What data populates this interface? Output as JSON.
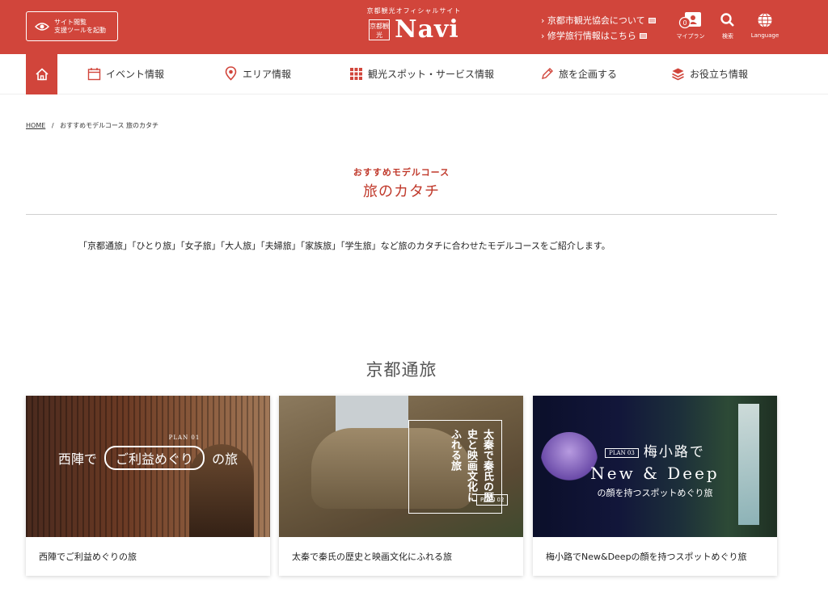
{
  "header": {
    "a11y_button": "サイト閲覧\n支援ツールを起動",
    "logo_tagline": "京都観光オフィシャルサイト",
    "logo_seal": "京都観光",
    "logo_name": "Navi",
    "links": [
      "京都市観光協会について",
      "修学旅行情報はこちら"
    ],
    "tools": {
      "myplan_count": "0",
      "myplan_label": "マイプラン",
      "search_label": "検索",
      "language_label": "Language"
    }
  },
  "nav": {
    "items": [
      "イベント情報",
      "エリア情報",
      "観光スポット・サービス情報",
      "旅を企画する",
      "お役立ち情報"
    ]
  },
  "breadcrumb": {
    "home": "HOME",
    "current": "おすすめモデルコース 旅のカタチ"
  },
  "page": {
    "subtitle": "おすすめモデルコース",
    "title": "旅のカタチ",
    "lead": "「京都通旅」「ひとり旅」「女子旅」「大人旅」「夫婦旅」「家族旅」「学生旅」など旅のカタチに合わせたモデルコースをご紹介します。"
  },
  "section": {
    "title": "京都通旅",
    "cards": [
      {
        "caption": "西陣でご利益めぐりの旅",
        "overlay_plan": "PLAN 01",
        "overlay_pre": "西陣で",
        "overlay_pill": "ご利益めぐり",
        "overlay_post": "の旅"
      },
      {
        "caption": "太秦で秦氏の歴史と映画文化にふれる旅",
        "overlay_text": "太秦で秦氏の歴史と映画文化にふれる旅",
        "overlay_plan": "PLAN 02"
      },
      {
        "caption": "梅小路でNew&Deepの顔を持つスポットめぐり旅",
        "overlay_plan": "PLAN 03",
        "overlay_l1": "梅小路で",
        "overlay_l2": "New & Deep",
        "overlay_l3": "の顔を持つスポットめぐり旅"
      }
    ]
  },
  "colors": {
    "brand": "#d1453b",
    "title_red": "#c0392b"
  }
}
